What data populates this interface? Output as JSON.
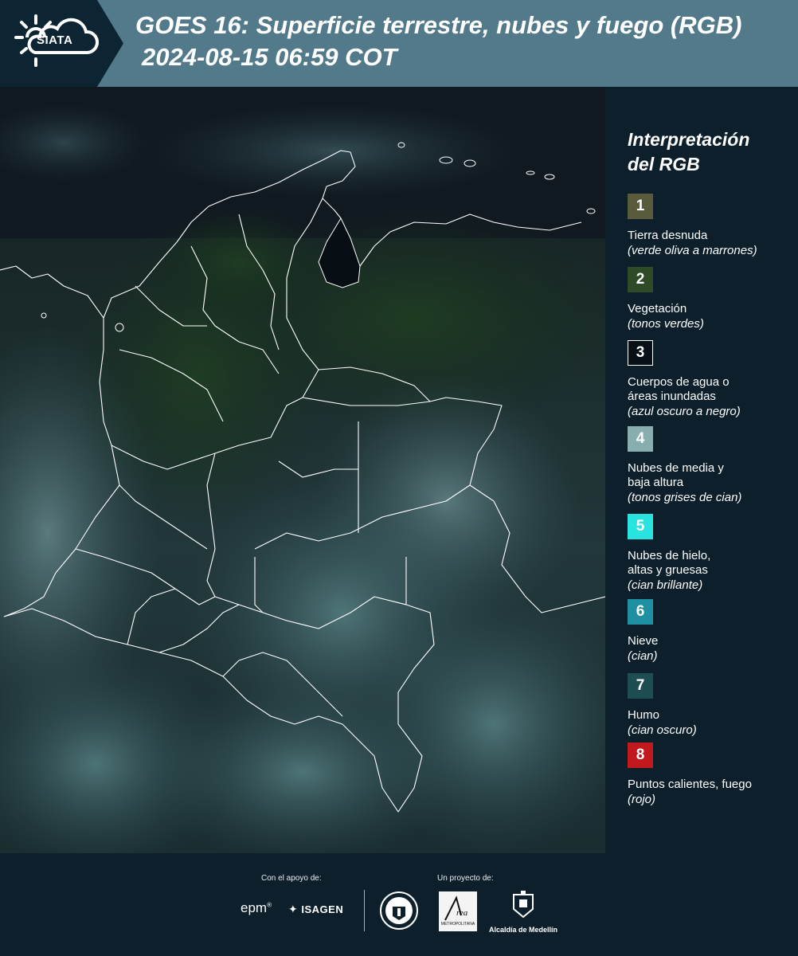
{
  "header": {
    "logo_text": "SIATA",
    "title": "GOES 16: Superficie terrestre, nubes y fuego (RGB)",
    "subtitle": "2024-08-15 06:59 COT"
  },
  "legend": {
    "title": "Interpretación\ndel RGB",
    "items": [
      {
        "number": "1",
        "label": "Tierra desnuda",
        "desc": "(verde oliva a marrones)",
        "color": "#5a5a3c",
        "text_color": "#ffffff"
      },
      {
        "number": "2",
        "label": "Vegetación",
        "desc": "(tonos verdes)",
        "color": "#2f4a26",
        "text_color": "#ffffff"
      },
      {
        "number": "3",
        "label": "Cuerpos de agua o\náreas inundadas",
        "desc": "(azul oscuro a negro)",
        "color": "#061016",
        "text_color": "#ffffff"
      },
      {
        "number": "4",
        "label": "Nubes de media y\nbaja altura",
        "desc": "(tonos grises de cian)",
        "color": "#88aeb0",
        "text_color": "#ffffff"
      },
      {
        "number": "5",
        "label": "Nubes de hielo,\naltas y gruesas",
        "desc": "(cian brillante)",
        "color": "#28e3e0",
        "text_color": "#ffffff"
      },
      {
        "number": "6",
        "label": "Nieve",
        "desc": "(cian)",
        "color": "#1f8fa2",
        "text_color": "#ffffff"
      },
      {
        "number": "7",
        "label": "Humo",
        "desc": "(cian oscuro)",
        "color": "#1d4e52",
        "text_color": "#ffffff"
      },
      {
        "number": "8",
        "label": "Puntos calientes, fuego",
        "desc": "(rojo)",
        "color": "#c1191d",
        "text_color": "#ffffff"
      }
    ]
  },
  "footer": {
    "support_label": "Con el apoyo de:",
    "project_label": "Un proyecto de:",
    "sponsor_epm": "epm",
    "sponsor_isagen": "ISAGEN",
    "area_text": "Área",
    "area_sub": "METROPOLITANA",
    "alcaldia": "Alcaldía de Medellín"
  }
}
